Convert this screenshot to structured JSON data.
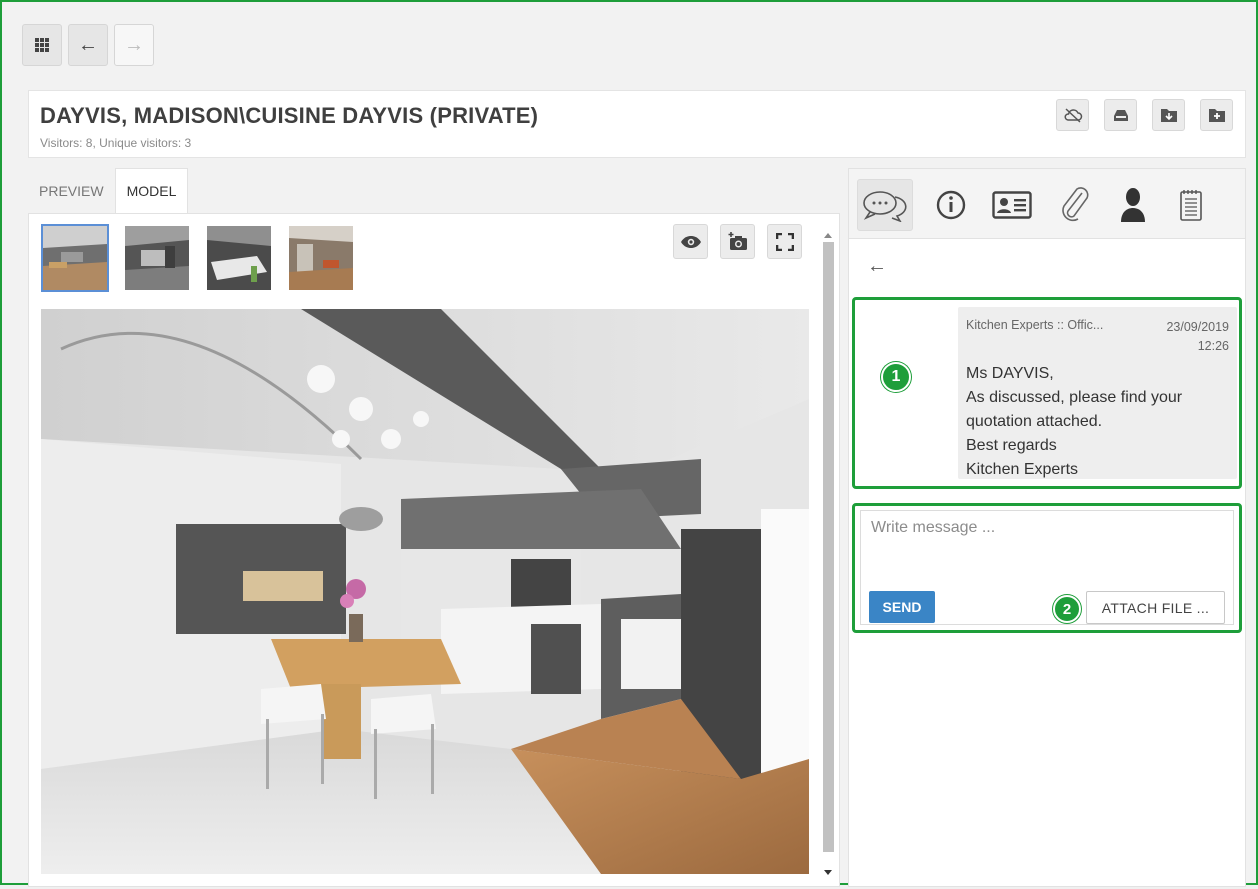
{
  "nav": {
    "icons": [
      "apps-grid-icon",
      "arrow-left-icon",
      "arrow-right-icon"
    ]
  },
  "header": {
    "title": "DAYVIS, MADISON\\CUISINE DAYVIS (PRIVATE)",
    "subtitle": "Visitors: 8, Unique visitors: 3",
    "icons": [
      "cloud-off-icon",
      "inbox-icon",
      "download-folder-icon",
      "add-folder-icon"
    ]
  },
  "tabs": [
    {
      "label": "PREVIEW",
      "active": false
    },
    {
      "label": "MODEL",
      "active": true
    }
  ],
  "viewer": {
    "thumbnails": 4,
    "active_thumbnail": 1,
    "tools": [
      "eye-icon",
      "camera-add-icon",
      "fullscreen-icon"
    ]
  },
  "sidepanel": {
    "icons": [
      "chat-bubble-icon",
      "info-icon",
      "contact-card-icon",
      "paperclip-icon",
      "person-icon",
      "notepad-icon"
    ],
    "active_icon": "chat-bubble-icon"
  },
  "message": {
    "sender": "Kitchen Experts :: Offic...",
    "date": "23/09/2019",
    "time": "12:26",
    "lines": [
      "Ms DAYVIS,",
      "As discussed, please find your",
      "quotation attached.",
      "Best regards",
      "Kitchen Experts"
    ]
  },
  "compose": {
    "placeholder": "Write message ...",
    "send_label": "SEND",
    "attach_label": "ATTACH FILE ..."
  },
  "annotations": {
    "badge1": "1",
    "badge2": "2"
  },
  "colors": {
    "accent_green": "#1e9e3a",
    "send_blue": "#3a85c6",
    "thumb_selected": "#5b8fd6"
  }
}
